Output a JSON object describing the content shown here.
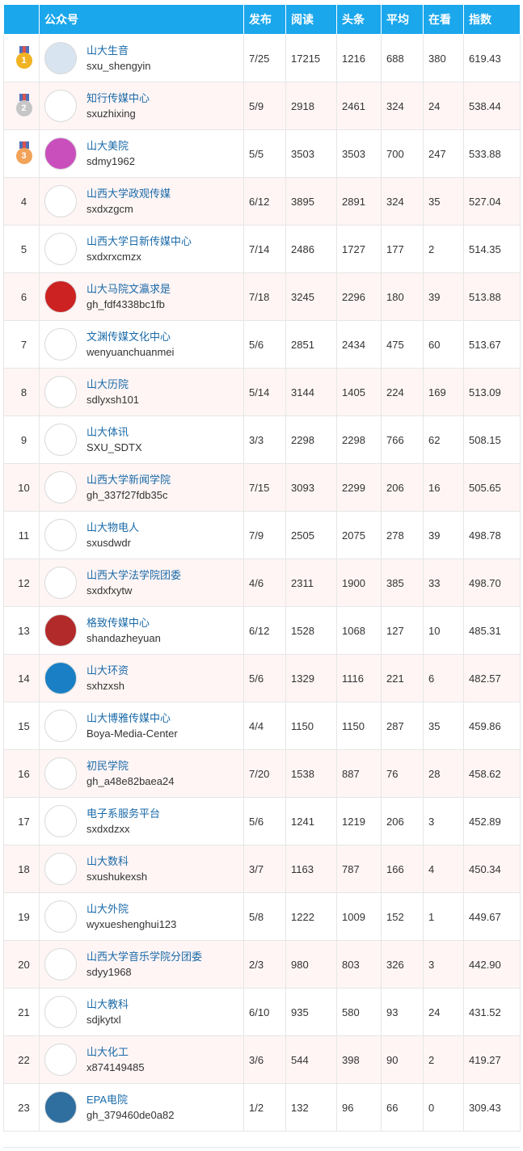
{
  "table": {
    "headers": [
      "",
      "公众号",
      "发布",
      "阅读",
      "头条",
      "平均",
      "在看",
      "指数"
    ],
    "rows": [
      {
        "rank": "1",
        "name": "山大生音",
        "id": "sxu_shengyin",
        "publish": "7/25",
        "reads": "17215",
        "headline": "1216",
        "avg": "688",
        "watching": "380",
        "score": "619.43"
      },
      {
        "rank": "2",
        "name": "知行传媒中心",
        "id": "sxuzhixing",
        "publish": "5/9",
        "reads": "2918",
        "headline": "2461",
        "avg": "324",
        "watching": "24",
        "score": "538.44"
      },
      {
        "rank": "3",
        "name": "山大美院",
        "id": "sdmy1962",
        "publish": "5/5",
        "reads": "3503",
        "headline": "3503",
        "avg": "700",
        "watching": "247",
        "score": "533.88"
      },
      {
        "rank": "4",
        "name": "山西大学政观传媒",
        "id": "sxdxzgcm",
        "publish": "6/12",
        "reads": "3895",
        "headline": "2891",
        "avg": "324",
        "watching": "35",
        "score": "527.04"
      },
      {
        "rank": "5",
        "name": "山西大学日新传媒中心",
        "id": "sxdxrxcmzx",
        "publish": "7/14",
        "reads": "2486",
        "headline": "1727",
        "avg": "177",
        "watching": "2",
        "score": "514.35"
      },
      {
        "rank": "6",
        "name": "山大马院文瀛求是",
        "id": "gh_fdf4338bc1fb",
        "publish": "7/18",
        "reads": "3245",
        "headline": "2296",
        "avg": "180",
        "watching": "39",
        "score": "513.88"
      },
      {
        "rank": "7",
        "name": "文渊传媒文化中心",
        "id": "wenyuanchuanmei",
        "publish": "5/6",
        "reads": "2851",
        "headline": "2434",
        "avg": "475",
        "watching": "60",
        "score": "513.67"
      },
      {
        "rank": "8",
        "name": "山大历院",
        "id": "sdlyxsh101",
        "publish": "5/14",
        "reads": "3144",
        "headline": "1405",
        "avg": "224",
        "watching": "169",
        "score": "513.09"
      },
      {
        "rank": "9",
        "name": "山大体讯",
        "id": "SXU_SDTX",
        "publish": "3/3",
        "reads": "2298",
        "headline": "2298",
        "avg": "766",
        "watching": "62",
        "score": "508.15"
      },
      {
        "rank": "10",
        "name": "山西大学新闻学院",
        "id": "gh_337f27fdb35c",
        "publish": "7/15",
        "reads": "3093",
        "headline": "2299",
        "avg": "206",
        "watching": "16",
        "score": "505.65"
      },
      {
        "rank": "11",
        "name": "山大物电人",
        "id": "sxusdwdr",
        "publish": "7/9",
        "reads": "2505",
        "headline": "2075",
        "avg": "278",
        "watching": "39",
        "score": "498.78"
      },
      {
        "rank": "12",
        "name": "山西大学法学院团委",
        "id": "sxdxfxytw",
        "publish": "4/6",
        "reads": "2311",
        "headline": "1900",
        "avg": "385",
        "watching": "33",
        "score": "498.70"
      },
      {
        "rank": "13",
        "name": "格致传媒中心",
        "id": "shandazheyuan",
        "publish": "6/12",
        "reads": "1528",
        "headline": "1068",
        "avg": "127",
        "watching": "10",
        "score": "485.31"
      },
      {
        "rank": "14",
        "name": "山大环资",
        "id": "sxhzxsh",
        "publish": "5/6",
        "reads": "1329",
        "headline": "1116",
        "avg": "221",
        "watching": "6",
        "score": "482.57"
      },
      {
        "rank": "15",
        "name": "山大博雅传媒中心",
        "id": "Boya-Media-Center",
        "publish": "4/4",
        "reads": "1150",
        "headline": "1150",
        "avg": "287",
        "watching": "35",
        "score": "459.86"
      },
      {
        "rank": "16",
        "name": "初民学院",
        "id": "gh_a48e82baea24",
        "publish": "7/20",
        "reads": "1538",
        "headline": "887",
        "avg": "76",
        "watching": "28",
        "score": "458.62"
      },
      {
        "rank": "17",
        "name": "电子系服务平台",
        "id": "sxdxdzxx",
        "publish": "5/6",
        "reads": "1241",
        "headline": "1219",
        "avg": "206",
        "watching": "3",
        "score": "452.89"
      },
      {
        "rank": "18",
        "name": "山大数科",
        "id": "sxushukexsh",
        "publish": "3/7",
        "reads": "1163",
        "headline": "787",
        "avg": "166",
        "watching": "4",
        "score": "450.34"
      },
      {
        "rank": "19",
        "name": "山大外院",
        "id": "wyxueshenghui123",
        "publish": "5/8",
        "reads": "1222",
        "headline": "1009",
        "avg": "152",
        "watching": "1",
        "score": "449.67"
      },
      {
        "rank": "20",
        "name": "山西大学音乐学院分团委",
        "id": "sdyy1968",
        "publish": "2/3",
        "reads": "980",
        "headline": "803",
        "avg": "326",
        "watching": "3",
        "score": "442.90"
      },
      {
        "rank": "21",
        "name": "山大教科",
        "id": "sdjkytxl",
        "publish": "6/10",
        "reads": "935",
        "headline": "580",
        "avg": "93",
        "watching": "24",
        "score": "431.52"
      },
      {
        "rank": "22",
        "name": "山大化工",
        "id": "x874149485",
        "publish": "3/6",
        "reads": "544",
        "headline": "398",
        "avg": "90",
        "watching": "2",
        "score": "419.27"
      },
      {
        "rank": "23",
        "name": "EPA电院",
        "id": "gh_379460de0a82",
        "publish": "1/2",
        "reads": "132",
        "headline": "96",
        "avg": "66",
        "watching": "0",
        "score": "309.43"
      }
    ]
  },
  "colors": {
    "header_bg": "#1aa7ec",
    "rank_text": "#1a8fd3",
    "score_text": "#1a8fd3",
    "name_text": "#1a6aa8",
    "alt_row_bg": "#fff5f5",
    "medal_gold": "#f0b323",
    "medal_silver": "#c6c6c6",
    "medal_bronze": "#f2a35a"
  },
  "avatar_colors": [
    "#d8e4ef",
    "#ffffff",
    "#c94fbd",
    "#ffffff",
    "#ffffff",
    "#cc2222",
    "#ffffff",
    "#ffffff",
    "#ffffff",
    "#ffffff",
    "#ffffff",
    "#ffffff",
    "#b32a2a",
    "#1a7fc4",
    "#ffffff",
    "#ffffff",
    "#ffffff",
    "#ffffff",
    "#ffffff",
    "#ffffff",
    "#ffffff",
    "#ffffff",
    "#2f6f9f"
  ]
}
